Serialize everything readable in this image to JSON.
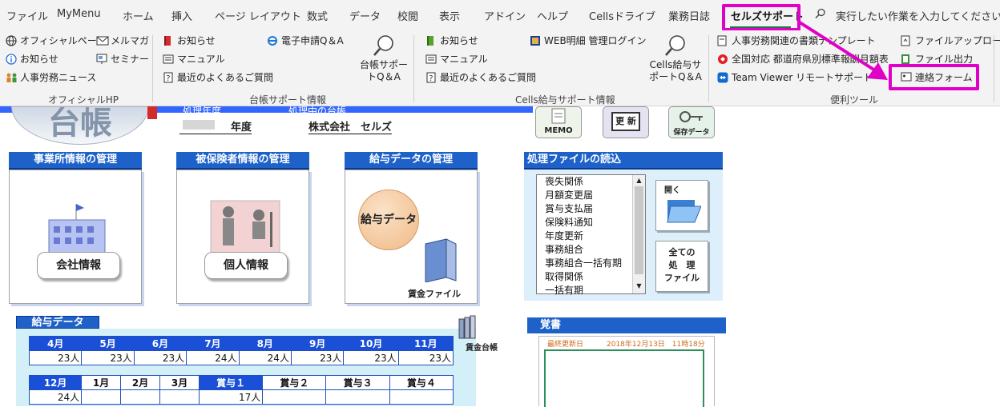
{
  "ribbon_tabs": [
    "ファイル",
    "MyMenu",
    "ホーム",
    "挿入",
    "ページ レイアウト",
    "数式",
    "データ",
    "校閲",
    "表示",
    "アドイン",
    "ヘルプ",
    "Cellsドライブ",
    "業務日誌",
    "セルズサポート"
  ],
  "tell_me": "実行したい作業を入力してください",
  "groups": {
    "official": {
      "label": "オフィシャルHP",
      "items": [
        "オフィシャルページ",
        "メルマガ",
        "お知らせ",
        "セミナー",
        "人事労務ニュース"
      ]
    },
    "daicho": {
      "label": "台帳サポート情報",
      "items": [
        "お知らせ",
        "マニュアル",
        "最近のよくあるご質問",
        "電子申請Q＆A"
      ],
      "big": [
        "台帳サポー",
        "トQ＆A"
      ]
    },
    "cells": {
      "label": "Cells給与サポート情報",
      "items": [
        "お知らせ",
        "マニュアル",
        "最近のよくあるご質問",
        "WEB明細 管理ログイン"
      ],
      "big": [
        "Cells給与サ",
        "ポートQ＆A"
      ]
    },
    "benri": {
      "label": "便利ツール",
      "items": [
        "人事労務関連の書類テンプレート",
        "全国対応 都道府県別標準報酬月額表",
        "Team Viewer リモートサポート",
        "ファイルアップロード",
        "ファイル出力",
        "連絡フォーム"
      ]
    }
  },
  "sheet": {
    "logo": "台帳",
    "top_labels": [
      "処理年度",
      "処理中の台帳"
    ],
    "nendo": "年度",
    "company": "株式会社　セルズ",
    "icons": [
      "MEMO",
      "更 新",
      "保存データ"
    ],
    "panels": {
      "jigyosho": {
        "title": "事業所情報の管理",
        "button": "会社情報"
      },
      "hihokensha": {
        "title": "被保険者情報の管理",
        "button": "個人情報"
      },
      "kyuyo": {
        "title": "給与データの管理",
        "button": "給与データ",
        "sub": "賃金ファイル"
      }
    },
    "file_load": {
      "title": "処理ファイルの読込",
      "list": [
        "喪失関係",
        "月額変更届",
        "賞与支払届",
        "保険料通知",
        "年度更新",
        "事務組合",
        "事務組合一括有期",
        "取得関係",
        "一括有期"
      ],
      "open": "開く",
      "all_files": [
        "全ての",
        "処　理",
        "ファイル"
      ]
    },
    "kyuyo_data": {
      "title": "給与データ",
      "row1_months": [
        "4月",
        "5月",
        "6月",
        "7月",
        "8月",
        "9月",
        "10月",
        "11月"
      ],
      "row1_values": [
        "23人",
        "23人",
        "23人",
        "24人",
        "24人",
        "23人",
        "23人",
        "23人"
      ],
      "row2_months": [
        "12月",
        "1月",
        "2月",
        "3月",
        "賞与１",
        "賞与２",
        "賞与３",
        "賞与４"
      ],
      "row2_values": [
        "24人",
        "",
        "",
        "",
        "17人",
        "",
        "",
        ""
      ],
      "ledger": "賃金台帳"
    },
    "memo": {
      "title": "覚書",
      "updated_label": "最終更新日",
      "updated_value": "2018年12月13日　11時18分"
    }
  },
  "colors": {
    "highlight": "#e100c8",
    "panel_header": "#1e62c9",
    "table_header": "#1a4fd8"
  }
}
